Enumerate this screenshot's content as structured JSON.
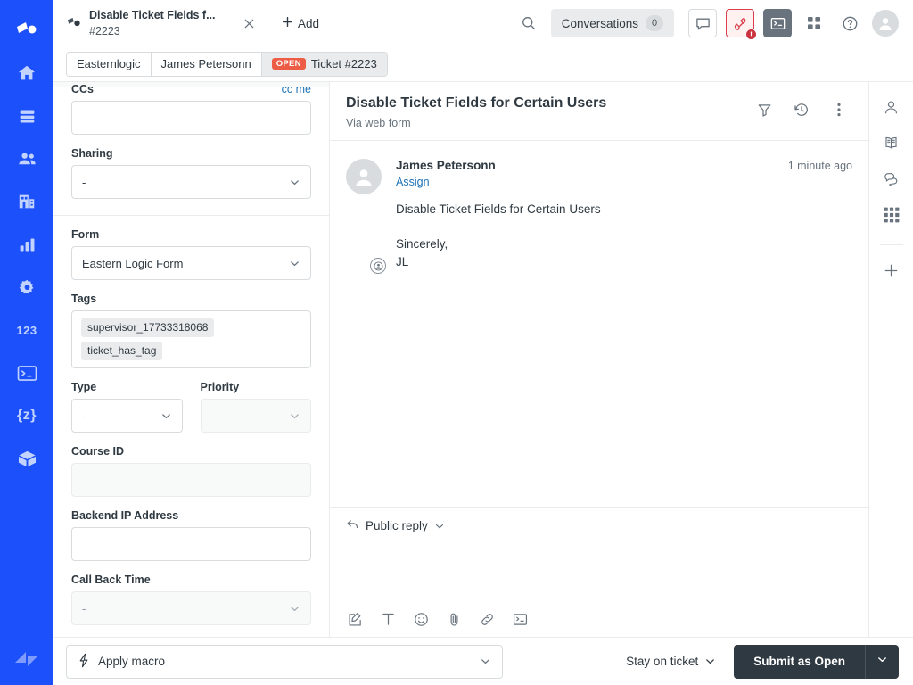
{
  "nav": {
    "items": [
      {
        "name": "zendesk-logo",
        "icon": "zendesk-logo-icon",
        "label": "Zendesk"
      },
      {
        "name": "home",
        "icon": "home-icon",
        "label": "Home"
      },
      {
        "name": "views",
        "icon": "views-icon",
        "label": "Views"
      },
      {
        "name": "customers",
        "icon": "customers-icon",
        "label": "Customers"
      },
      {
        "name": "organizations",
        "icon": "organizations-icon",
        "label": "Organizations"
      },
      {
        "name": "reporting",
        "icon": "bar-chart-icon",
        "label": "Reporting"
      },
      {
        "name": "admin",
        "icon": "gear-icon",
        "label": "Admin"
      },
      {
        "name": "numbers",
        "icon": "123-text-icon",
        "label": "123"
      },
      {
        "name": "terminal",
        "icon": "terminal-icon",
        "label": "Terminal"
      },
      {
        "name": "z-brackets",
        "icon": "curly-z-icon",
        "label": "{z}"
      },
      {
        "name": "package",
        "icon": "cube-icon",
        "label": "Package"
      }
    ],
    "footer_icon": "zendesk-mark-icon"
  },
  "topbar": {
    "tab": {
      "icon": "ticket-tab-icon",
      "title": "Disable Ticket Fields f...",
      "subtitle": "#2223",
      "close_icon": "close-icon"
    },
    "add_label": "Add",
    "add_icon": "plus-icon",
    "search_icon": "search-icon",
    "conversations_label": "Conversations",
    "conversations_count": "0",
    "chat_icon": "chat-bubble-icon",
    "call_icon": "phone-icon",
    "call_error_badge": "!",
    "console_icon": "terminal-icon",
    "apps_icon": "apps-grid-icon",
    "help_icon": "help-circle-icon",
    "avatar_icon": "user-avatar-icon"
  },
  "breadcrumb": {
    "items": [
      {
        "label": "Easternlogic",
        "badge": null
      },
      {
        "label": "James Petersonn",
        "badge": null
      },
      {
        "label": "Ticket #2223",
        "badge": "OPEN"
      }
    ]
  },
  "form": {
    "fields": [
      {
        "key": "ccs",
        "label": "CCs",
        "type": "input",
        "value": "",
        "action_label": "cc me",
        "muted": false
      },
      {
        "key": "sharing",
        "label": "Sharing",
        "type": "select",
        "value": "-",
        "muted": false
      },
      {
        "key": "form",
        "label": "Form",
        "type": "select",
        "value": "Eastern Logic Form",
        "muted": false
      },
      {
        "key": "type",
        "label": "Type",
        "type": "select",
        "value": "-",
        "muted": false
      },
      {
        "key": "priority",
        "label": "Priority",
        "type": "select",
        "value": "-",
        "muted": true
      },
      {
        "key": "course_id",
        "label": "Course ID",
        "type": "input",
        "value": "",
        "muted": true
      },
      {
        "key": "backend_ip",
        "label": "Backend IP Address",
        "type": "input",
        "value": "",
        "muted": false
      },
      {
        "key": "call_back_time",
        "label": "Call Back Time",
        "type": "select",
        "value": "-",
        "muted": true
      }
    ],
    "tags_label": "Tags",
    "tags": [
      "supervisor_17733318068",
      "ticket_has_tag"
    ]
  },
  "ticket": {
    "title": "Disable Ticket Fields for Certain Users",
    "via": "Via web form",
    "header_icons": {
      "filter": "filter-icon",
      "history": "history-icon",
      "more": "more-vertical-icon"
    },
    "message": {
      "author": "James Petersonn",
      "assign_label": "Assign",
      "time": "1 minute ago",
      "body": "Disable Ticket Fields for Certain Users\n\nSincerely,\nJL",
      "avatar_icon": "user-avatar-icon",
      "assign_icon": "assign-user-icon"
    }
  },
  "composer": {
    "reply_mode": "Public reply",
    "reply_icon": "reply-arrow-icon",
    "chevron_icon": "chevron-down-icon",
    "tools": [
      {
        "name": "compose",
        "icon": "compose-icon"
      },
      {
        "name": "text-format",
        "icon": "text-format-icon"
      },
      {
        "name": "emoji",
        "icon": "emoji-icon"
      },
      {
        "name": "attachment",
        "icon": "paperclip-icon"
      },
      {
        "name": "link",
        "icon": "link-icon"
      },
      {
        "name": "macro-console",
        "icon": "terminal-icon"
      }
    ]
  },
  "right_rail": {
    "items": [
      {
        "name": "customer-context",
        "icon": "user-icon"
      },
      {
        "name": "knowledge",
        "icon": "book-icon"
      },
      {
        "name": "conversations",
        "icon": "chat-bubbles-icon"
      },
      {
        "name": "apps",
        "icon": "apps-grid-icon",
        "active": true
      }
    ],
    "add_icon": "plus-icon"
  },
  "footer": {
    "macro_label": "Apply macro",
    "macro_icon": "lightning-icon",
    "stay_label": "Stay on ticket",
    "submit_label": "Submit as Open",
    "submit_caret_icon": "chevron-down-icon"
  },
  "colors": {
    "nav_blue": "#1b50fa",
    "accent_link": "#1f73b7",
    "open_badge": "#ed5c45",
    "danger": "#cc3340",
    "dark": "#2f3941"
  }
}
